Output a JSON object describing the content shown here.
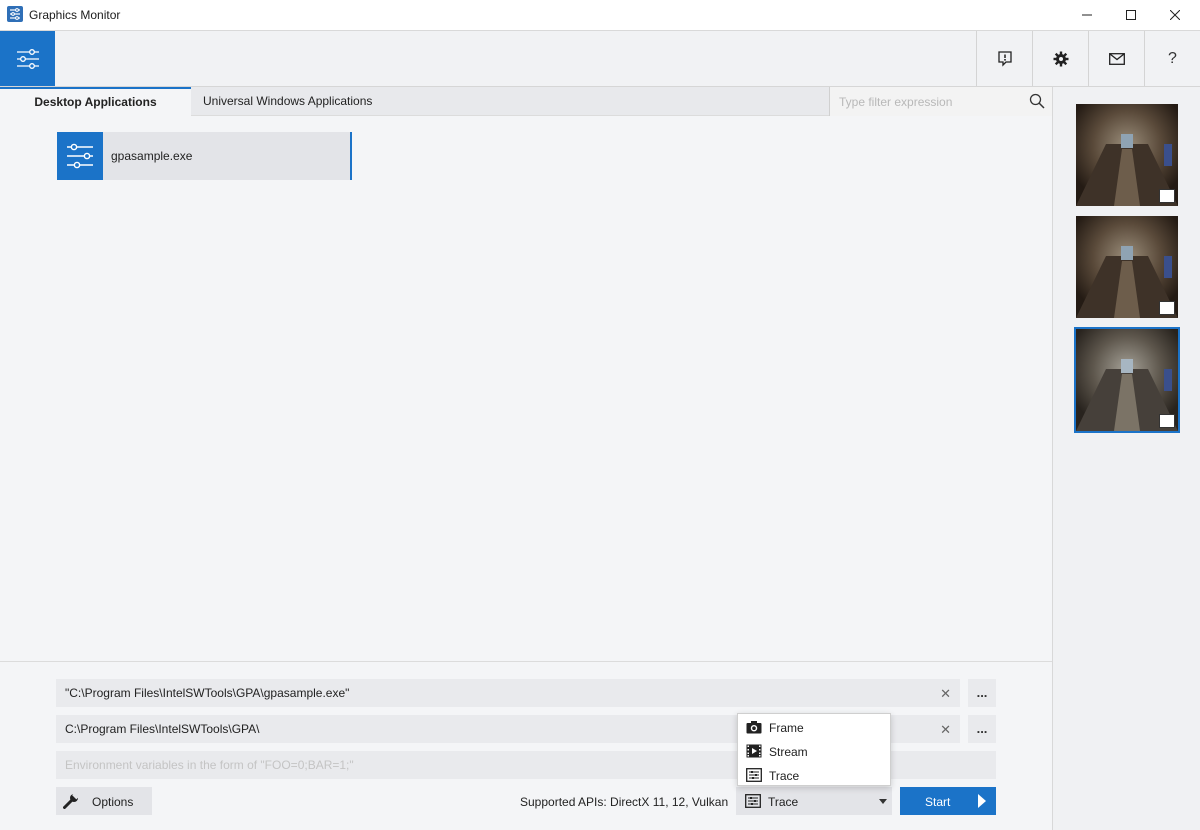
{
  "window": {
    "title": "Graphics Monitor",
    "icon": "app-icon",
    "controls": {
      "minimize": "minimize-icon",
      "maximize": "maximize-icon",
      "close": "close-icon"
    }
  },
  "toolbar": {
    "home_icon": "sliders-icon",
    "buttons": [
      {
        "icon": "feedback-icon"
      },
      {
        "icon": "gear-icon"
      },
      {
        "icon": "mail-icon"
      },
      {
        "icon": "help-icon",
        "label": "?"
      }
    ]
  },
  "tabs": {
    "items": [
      {
        "label": "Desktop Applications",
        "active": true
      },
      {
        "label": "Universal Windows Applications",
        "active": false
      }
    ],
    "filter_placeholder": "Type filter expression",
    "filter_icon": "search-icon"
  },
  "applications": [
    {
      "name": "gpasample.exe",
      "icon": "sliders-icon",
      "selected": true
    }
  ],
  "captures": [
    {
      "type": "trace",
      "badge_icon": "trace-icon",
      "selected": false
    },
    {
      "type": "stream",
      "badge_icon": "stream-icon",
      "selected": false
    },
    {
      "type": "frame",
      "badge_icon": "camera-icon",
      "selected": true
    }
  ],
  "launch": {
    "app_path": "\"C:\\Program Files\\IntelSWTools\\GPA\\gpasample.exe\"",
    "working_dir": "C:\\Program Files\\IntelSWTools\\GPA\\",
    "env_placeholder": "Environment variables in the form of \"FOO=0;BAR=1;\"",
    "browse_label": "...",
    "options_label": "Options",
    "supported_apis": "Supported APIs: DirectX 11, 12, Vulkan",
    "mode_selected": "Trace",
    "start_label": "Start",
    "mode_menu": [
      {
        "label": "Frame",
        "icon": "camera-icon"
      },
      {
        "label": "Stream",
        "icon": "stream-icon"
      },
      {
        "label": "Trace",
        "icon": "trace-icon"
      }
    ]
  },
  "colors": {
    "accent": "#1b73c8",
    "background": "#f4f5f7"
  }
}
